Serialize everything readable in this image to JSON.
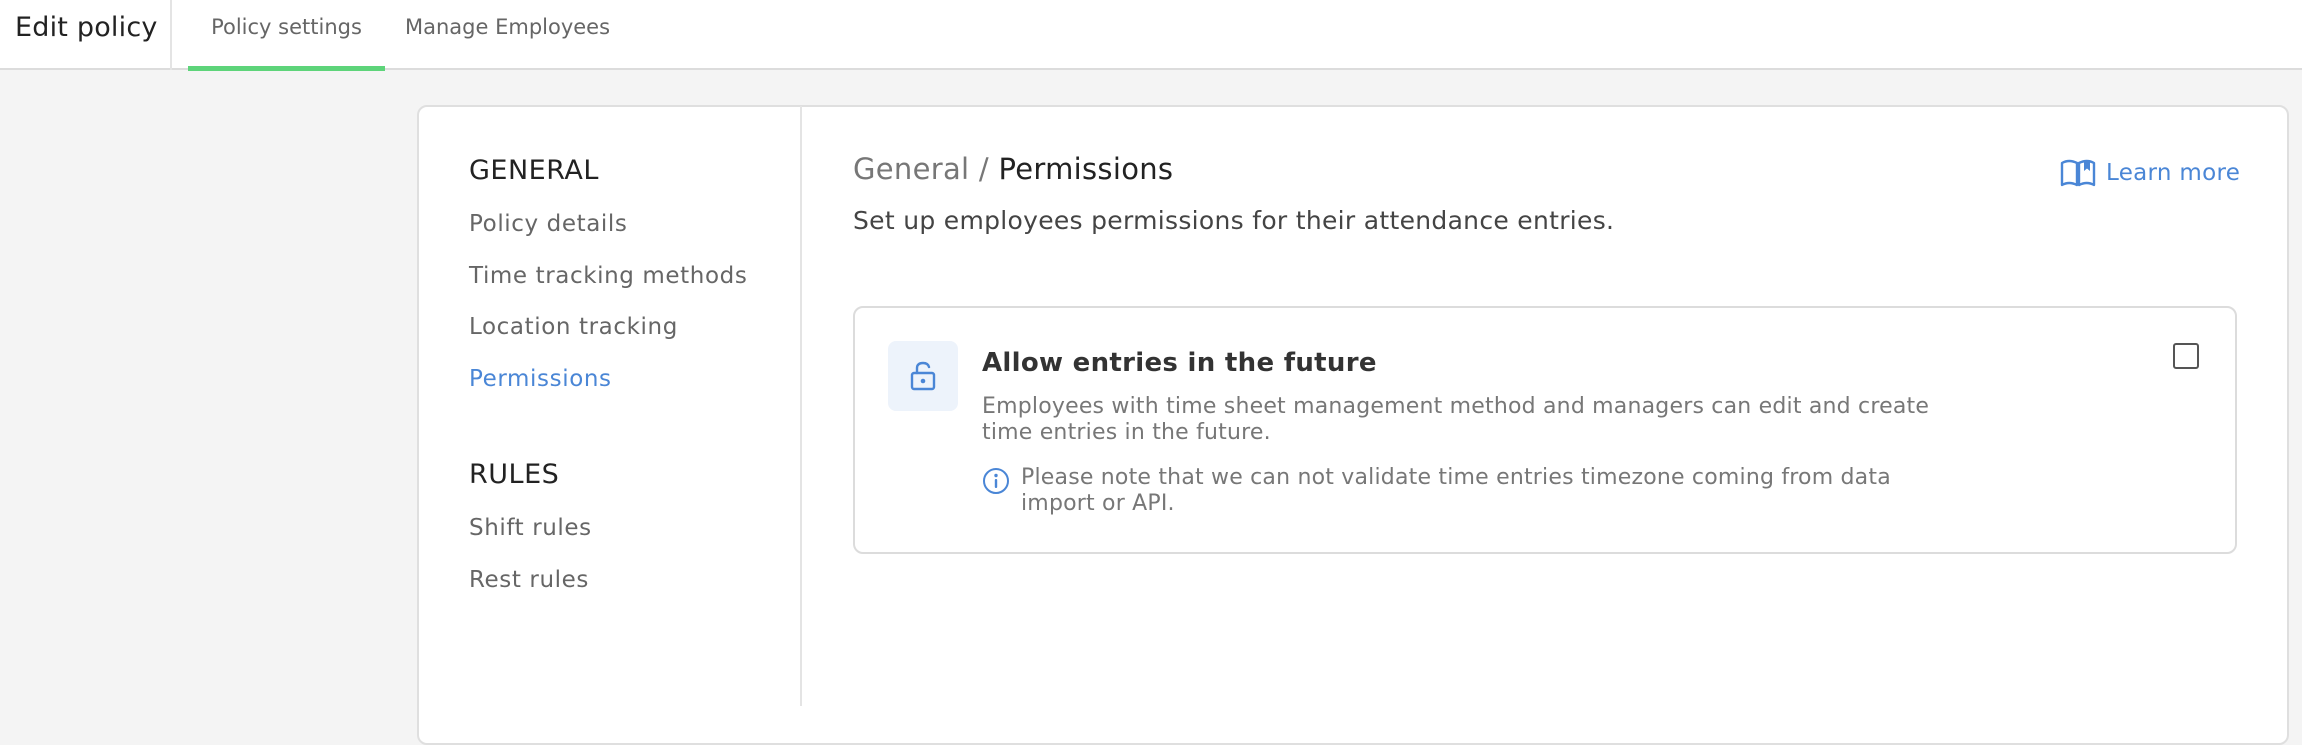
{
  "header": {
    "title": "Edit policy",
    "tabs": [
      {
        "label": "Policy settings",
        "active": true
      },
      {
        "label": "Manage Employees",
        "active": false
      }
    ]
  },
  "sidebar": {
    "sections": [
      {
        "heading": "GENERAL",
        "items": [
          {
            "label": "Policy details",
            "active": false
          },
          {
            "label": "Time tracking methods",
            "active": false
          },
          {
            "label": "Location tracking",
            "active": false
          },
          {
            "label": "Permissions",
            "active": true
          }
        ]
      },
      {
        "heading": "RULES",
        "items": [
          {
            "label": "Shift rules",
            "active": false
          },
          {
            "label": "Rest rules",
            "active": false
          }
        ]
      }
    ]
  },
  "main": {
    "breadcrumb": {
      "parent": "General",
      "separator": " / ",
      "current": "Permissions"
    },
    "subtitle": "Set up employees permissions for their attendance entries.",
    "learn_more": {
      "label": "Learn more",
      "icon": "book-icon"
    },
    "permission": {
      "icon": "lock-icon",
      "title": "Allow entries in the future",
      "description": "Employees with time sheet management method and managers can edit and create time entries in the future.",
      "note_icon": "info-icon",
      "note": "Please note that we can not validate time entries timezone coming from data import or API.",
      "checked": false
    }
  },
  "colors": {
    "accent": "#4a86d6",
    "tab_underline": "#5dd47a",
    "background": "#f4f4f4",
    "lock_tile": "#edf3fb"
  }
}
